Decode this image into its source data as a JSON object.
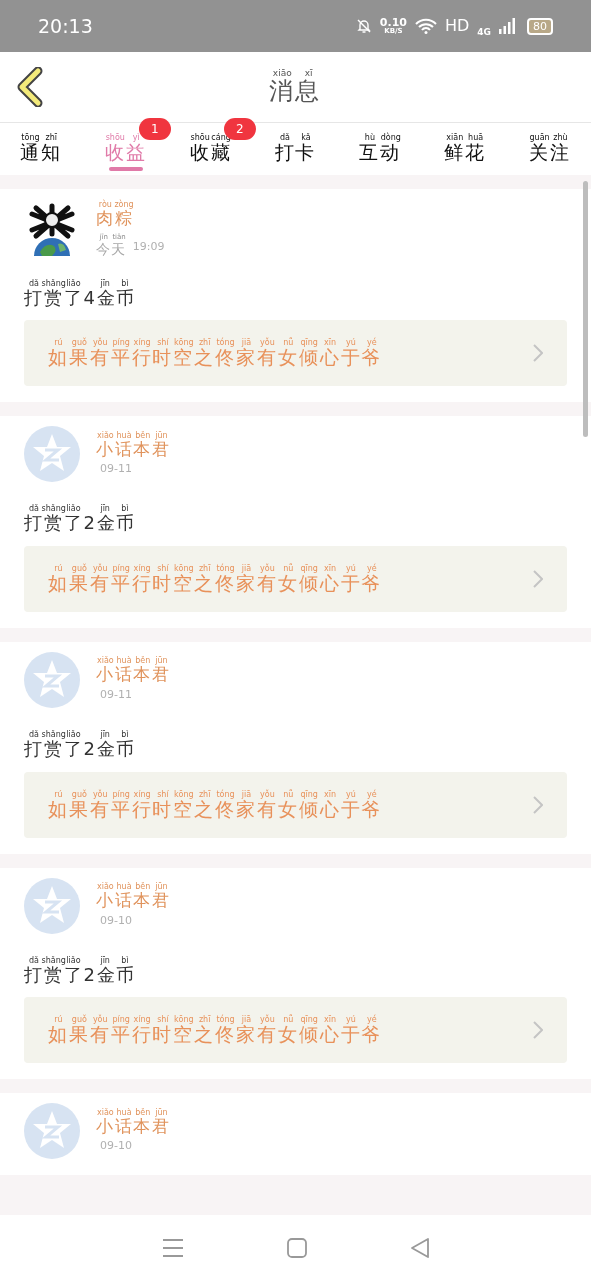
{
  "status_bar": {
    "time": "20:13",
    "speed": "0.10",
    "speed_unit": "KB/S",
    "hd": "HD",
    "network": "4G",
    "battery": "80"
  },
  "header": {
    "title": {
      "text": "消息",
      "pinyin": [
        "xiāo",
        "xī"
      ]
    }
  },
  "tabs": [
    {
      "text": "通知",
      "pinyin": [
        "tōng",
        "zhī"
      ],
      "selected": false
    },
    {
      "text": "收益",
      "pinyin": [
        "shōu",
        "yì"
      ],
      "selected": true,
      "badge": "1"
    },
    {
      "text": "收藏",
      "pinyin": [
        "shōu",
        "cáng"
      ],
      "selected": false,
      "badge": "2"
    },
    {
      "text": "打卡",
      "pinyin": [
        "dǎ",
        "kǎ"
      ],
      "selected": false
    },
    {
      "text": "互动",
      "pinyin": [
        "hù",
        "dòng"
      ],
      "selected": false
    },
    {
      "text": "鲜花",
      "pinyin": [
        "xiān",
        "huā"
      ],
      "selected": false
    },
    {
      "text": "关注",
      "pinyin": [
        "guān",
        "zhù"
      ],
      "selected": false
    }
  ],
  "messages": [
    {
      "name": {
        "text": "肉粽",
        "pinyin": [
          "ròu",
          "zòng"
        ]
      },
      "date": {
        "text": "今天",
        "pinyin": [
          "jīn",
          "tiān"
        ]
      },
      "time": "19:09",
      "action": {
        "text": "打赏了4金币",
        "pinyin": [
          "dǎ",
          "shǎng",
          "liǎo",
          "jīn",
          "bì"
        ]
      },
      "quote": {
        "text": "如果有平行时空之佟家有女倾心于爷",
        "pinyin": [
          "rú",
          "guǒ",
          "yǒu",
          "píng",
          "xíng",
          "shí",
          "kōng",
          "zhī",
          "tóng",
          "jiā",
          "yǒu",
          "nǚ",
          "qīng",
          "xīn",
          "yú",
          "yé"
        ]
      }
    },
    {
      "avatar": {
        "kind": "default"
      },
      "name": {
        "text": "小话本君",
        "pinyin": [
          "xiǎo",
          "huà",
          "běn",
          "jūn"
        ]
      },
      "time": "09-11",
      "action": {
        "text": "打赏了2金币",
        "pinyin": [
          "dǎ",
          "shǎng",
          "liǎo",
          "jīn",
          "bì"
        ]
      },
      "quote": {
        "text": "如果有平行时空之佟家有女倾心于爷",
        "pinyin": [
          "rú",
          "guǒ",
          "yǒu",
          "píng",
          "xíng",
          "shí",
          "kōng",
          "zhī",
          "tóng",
          "jiā",
          "yǒu",
          "nǚ",
          "qīng",
          "xīn",
          "yú",
          "yé"
        ]
      }
    },
    {
      "avatar": {
        "kind": "default"
      },
      "name": {
        "text": "小话本君",
        "pinyin": [
          "xiǎo",
          "huà",
          "běn",
          "jūn"
        ]
      },
      "time": "09-11",
      "action": {
        "text": "打赏了2金币",
        "pinyin": [
          "dǎ",
          "shǎng",
          "liǎo",
          "jīn",
          "bì"
        ]
      },
      "quote": {
        "text": "如果有平行时空之佟家有女倾心于爷",
        "pinyin": [
          "rú",
          "guǒ",
          "yǒu",
          "píng",
          "xíng",
          "shí",
          "kōng",
          "zhī",
          "tóng",
          "jiā",
          "yǒu",
          "nǚ",
          "qīng",
          "xīn",
          "yú",
          "yé"
        ]
      }
    },
    {
      "avatar": {
        "kind": "default"
      },
      "name": {
        "text": "小话本君",
        "pinyin": [
          "xiǎo",
          "huà",
          "běn",
          "jūn"
        ]
      },
      "time": "09-10",
      "action": {
        "text": "打赏了2金币",
        "pinyin": [
          "dǎ",
          "shǎng",
          "liǎo",
          "jīn",
          "bì"
        ]
      },
      "quote": {
        "text": "如果有平行时空之佟家有女倾心于爷",
        "pinyin": [
          "rú",
          "guǒ",
          "yǒu",
          "píng",
          "xíng",
          "shí",
          "kōng",
          "zhī",
          "tóng",
          "jiā",
          "yǒu",
          "nǚ",
          "qīng",
          "xīn",
          "yú",
          "yé"
        ]
      }
    },
    {
      "avatar": {
        "kind": "default"
      },
      "name": {
        "text": "小话本君",
        "pinyin": [
          "xiǎo",
          "huà",
          "běn",
          "jūn"
        ]
      },
      "time": "09-10"
    }
  ]
}
